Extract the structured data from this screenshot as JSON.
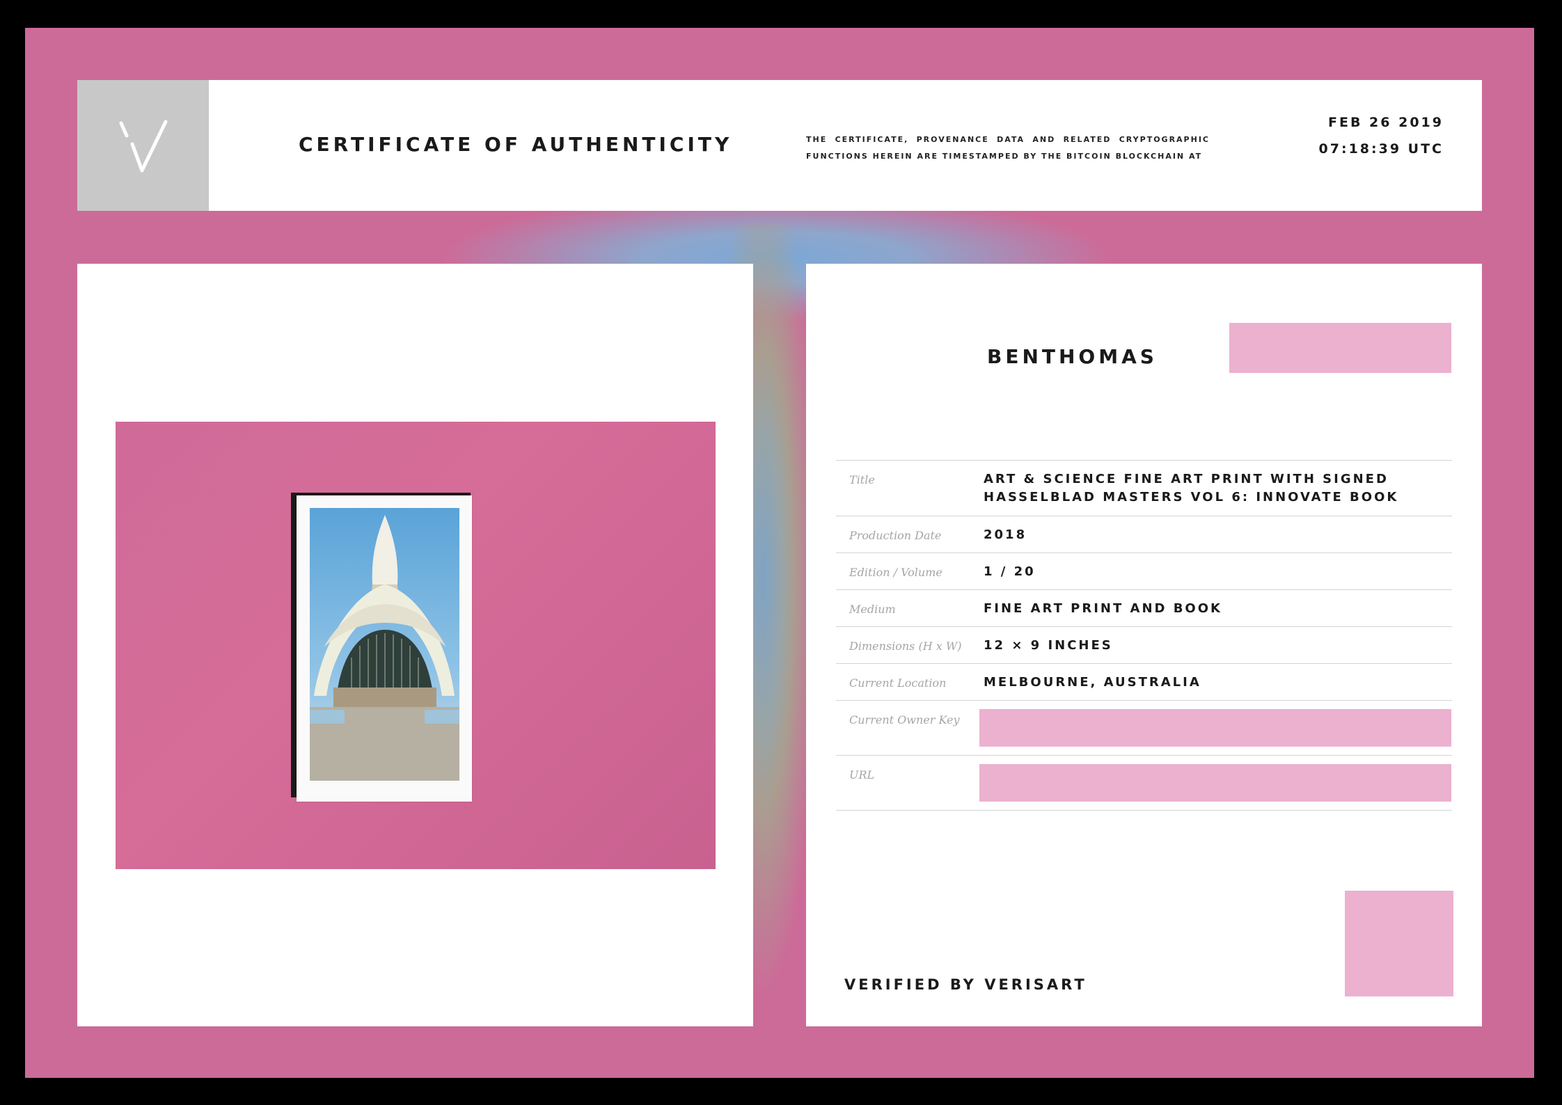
{
  "header": {
    "logo_icon": "verisart-v-logo-icon",
    "title": "CERTIFICATE OF AUTHENTICITY",
    "timestamp_note": "THE CERTIFICATE, PROVENANCE DATA AND RELATED CRYPTOGRAPHIC FUNCTIONS HEREIN ARE TIMESTAMPED BY THE BITCOIN BLOCKCHAIN AT",
    "date": "FEB 26 2019",
    "time": "07:18:39 UTC"
  },
  "artwork": {
    "image": "photograph-of-fine-art-print-on-pink-background"
  },
  "artist": "BENTHOMAS",
  "details": [
    {
      "label": "Title",
      "value": "ART & SCIENCE FINE ART PRINT WITH SIGNED HASSELBLAD MASTERS VOL 6: INNOVATE BOOK"
    },
    {
      "label": "Production Date",
      "value": "2018"
    },
    {
      "label": "Edition / Volume",
      "value": "1 / 20"
    },
    {
      "label": "Medium",
      "value": "FINE ART PRINT AND BOOK"
    },
    {
      "label": "Dimensions (H x W)",
      "value": "12 × 9 INCHES"
    },
    {
      "label": "Current Location",
      "value": "MELBOURNE, AUSTRALIA"
    },
    {
      "label": "Current Owner Key",
      "value": ""
    },
    {
      "label": "URL",
      "value": ""
    }
  ],
  "footer": {
    "verified": "VERIFIED BY VERISART"
  },
  "colors": {
    "frame": "#cc6b98",
    "redaction": "#ecb1cf",
    "logo_bg": "#c8c8c8"
  }
}
